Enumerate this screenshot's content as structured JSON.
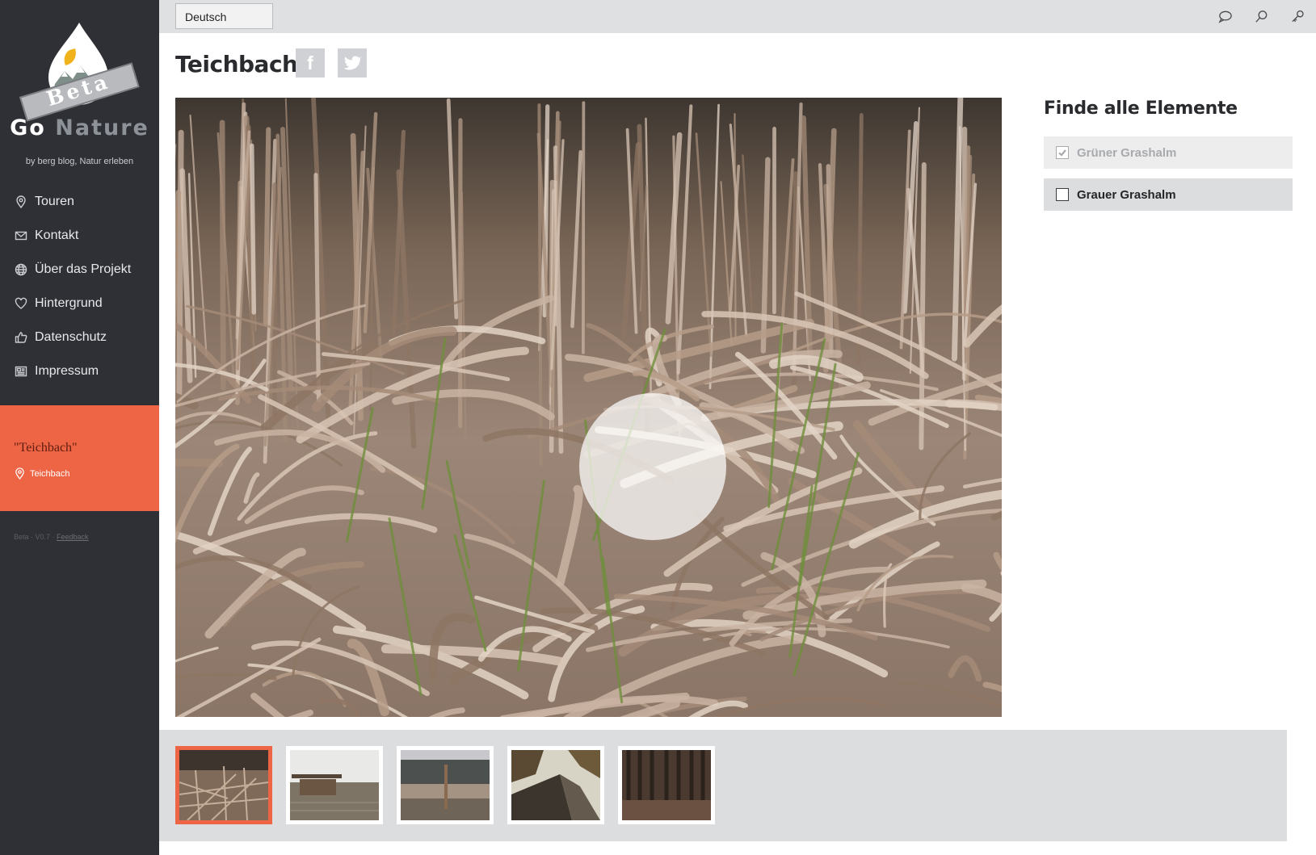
{
  "sidebar": {
    "logo": {
      "badge": "Beta",
      "brand_go": "Go",
      "brand_nature": "Nature",
      "byline": "by berg blog, Natur erleben"
    },
    "nav": [
      {
        "label": "Touren",
        "icon": "map-pin-icon"
      },
      {
        "label": "Kontakt",
        "icon": "mail-icon"
      },
      {
        "label": "Über das Projekt",
        "icon": "globe-icon"
      },
      {
        "label": "Hintergrund",
        "icon": "heart-icon"
      },
      {
        "label": "Datenschutz",
        "icon": "thumbs-up-icon"
      },
      {
        "label": "Impressum",
        "icon": "newspaper-icon"
      }
    ],
    "active_tour": {
      "quote": "\"Teichbach\"",
      "location": "Teichbach"
    },
    "version": {
      "text": "Beta · V0.7 · ",
      "feedback": "Feedback"
    }
  },
  "topbar": {
    "language": "Deutsch",
    "icons": [
      "chat-icon",
      "search-icon",
      "key-icon"
    ]
  },
  "main": {
    "title": "Teichbach",
    "share": [
      {
        "label": "f",
        "icon": "facebook-icon"
      },
      {
        "label": "",
        "icon": "twitter-icon"
      }
    ]
  },
  "panel": {
    "title": "Finde alle Elemente",
    "items": [
      {
        "label": "Grüner Grashalm",
        "checked": true
      },
      {
        "label": "Grauer Grashalm",
        "checked": false
      }
    ]
  },
  "thumbnails": {
    "selected_index": 0,
    "count": 5
  },
  "colors": {
    "accent": "#ee6545",
    "sidebar": "#2f3036",
    "topbar": "#dfe0e2"
  }
}
